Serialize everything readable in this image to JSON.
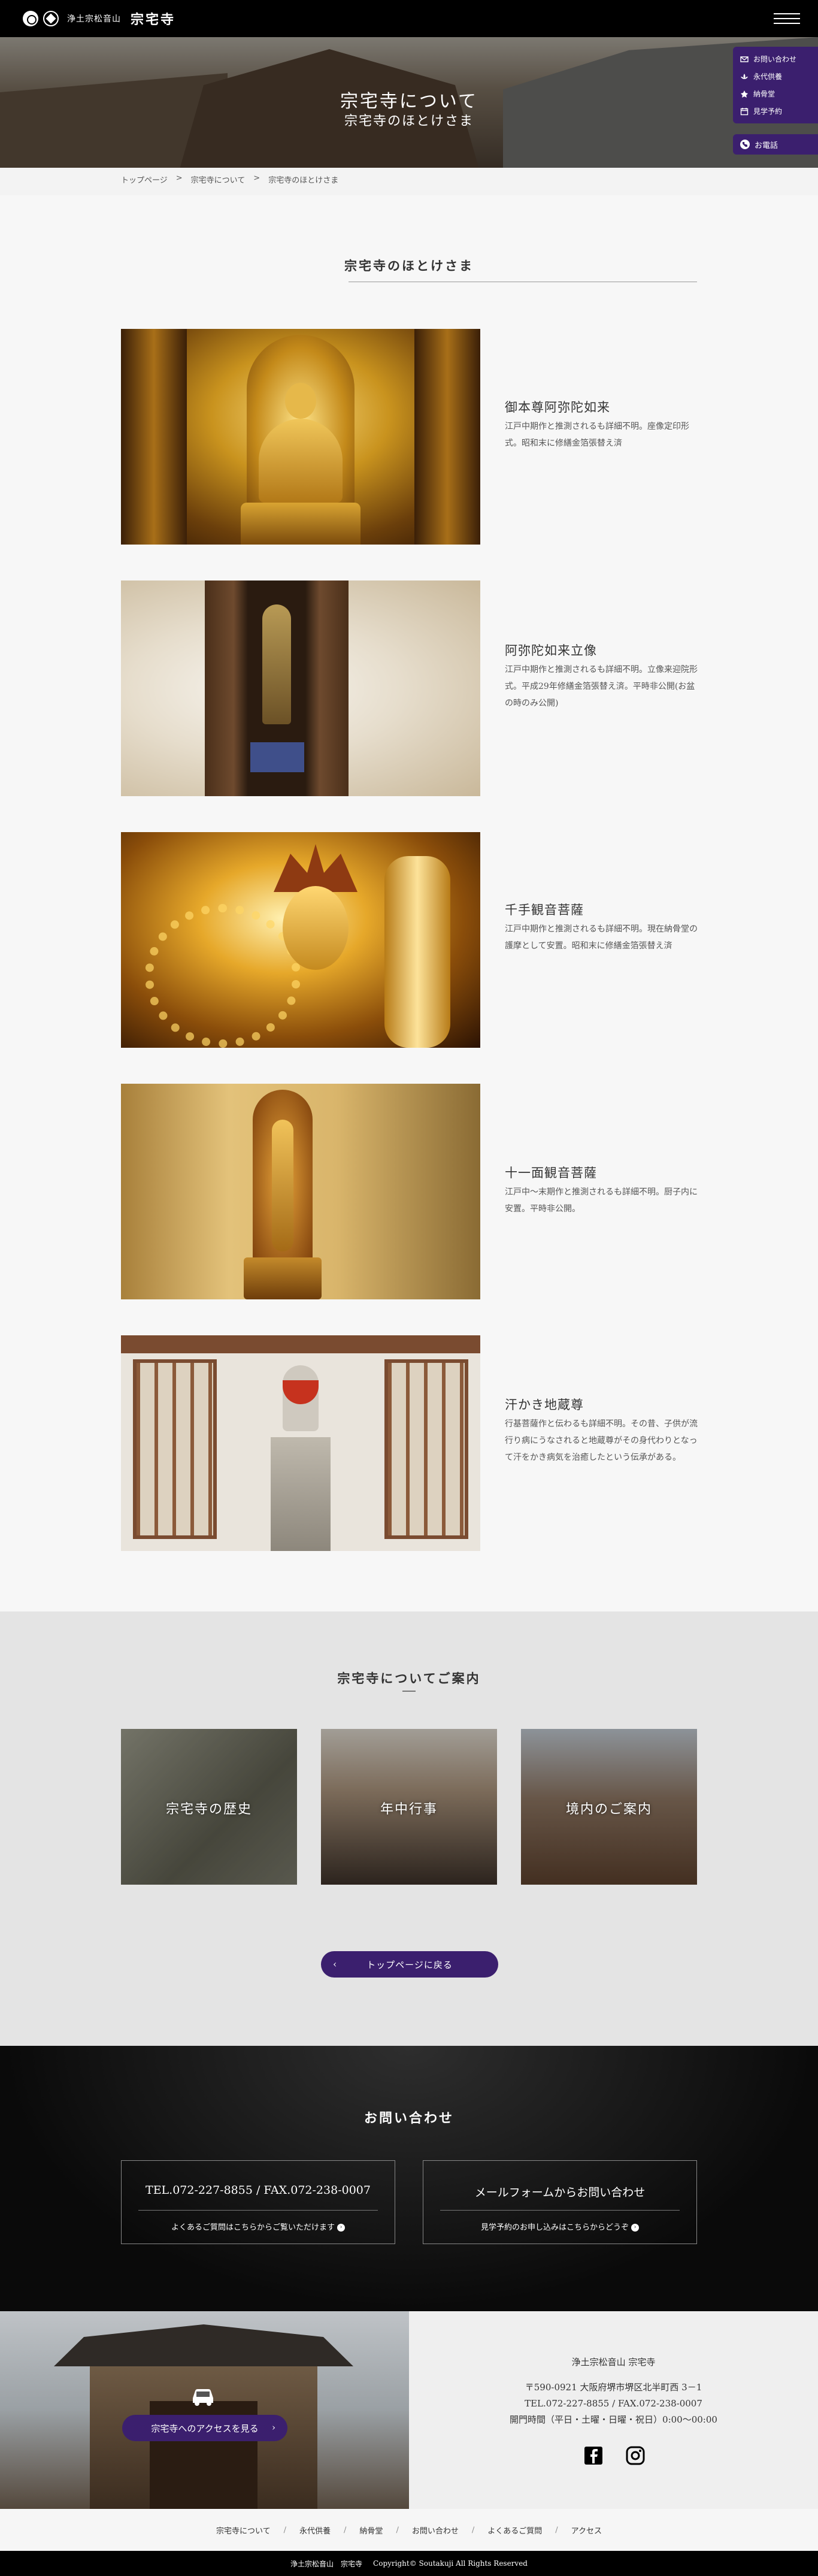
{
  "header": {
    "logo_sub": "浄土宗松音山",
    "logo_main": "宗宅寺"
  },
  "hero": {
    "title": "宗宅寺について",
    "subtitle": "宗宅寺のほとけさま"
  },
  "side_nav": {
    "items": [
      {
        "label": "お問い合わせ",
        "icon": "mail-icon"
      },
      {
        "label": "永代供養",
        "icon": "lotus-icon"
      },
      {
        "label": "納骨堂",
        "icon": "flower-icon"
      },
      {
        "label": "見学予約",
        "icon": "calendar-icon"
      }
    ],
    "call_label": "お電話"
  },
  "breadcrumb": {
    "items": [
      "トップページ",
      ">",
      "宗宅寺について",
      ">",
      "宗宅寺のほとけさま"
    ]
  },
  "main": {
    "title": "宗宅寺のほとけさま",
    "items": [
      {
        "name": "御本尊阿弥陀如来",
        "desc": "江戸中期作と推測されるも詳細不明。座像定印形式。昭和末に修繕金箔張替え済"
      },
      {
        "name": "阿弥陀如来立像",
        "desc": "江戸中期作と推測されるも詳細不明。立像来迎院形式。平成29年修繕金箔張替え済。平時非公開(お盆の時のみ公開)"
      },
      {
        "name": "千手観音菩薩",
        "desc": "江戸中期作と推測されるも詳細不明。現在納骨堂の護摩として安置。昭和末に修繕金箔張替え済"
      },
      {
        "name": "十一面観音菩薩",
        "desc": "江戸中〜末期作と推測されるも詳細不明。厨子内に安置。平時非公開。"
      },
      {
        "name": "汗かき地蔵尊",
        "desc": "行基菩薩作と伝わるも詳細不明。その昔、子供が流行り病にうなされると地蔵尊がその身代わりとなって汗をかき病気を治癒したという伝承がある。"
      }
    ]
  },
  "guide": {
    "title": "宗宅寺についてご案内",
    "cards": [
      "宗宅寺の歴史",
      "年中行事",
      "境内のご案内"
    ],
    "back_label": "トップページに戻る"
  },
  "contact": {
    "title": "お問い合わせ",
    "phone_main": "TEL.072-227-8855 / FAX.072-238-0007",
    "phone_sub": "よくあるご質問はこちらからご覧いただけます",
    "mail_main": "メールフォームからお問い合わせ",
    "mail_sub": "見学予約のお申し込みはこちらからどうぞ"
  },
  "footer": {
    "access_label": "宗宅寺へのアクセスを見る",
    "org_sub": "浄土宗松音山 宗宅寺",
    "address": "〒590-0921 大阪府堺市堺区北半町西 3－1",
    "tel": "TEL.072-227-8855 / FAX.072-238-0007",
    "hours": "開門時間（平日・土曜・日曜・祝日）0:00～00:00",
    "links": [
      "宗宅寺について",
      "永代供養",
      "納骨堂",
      "お問い合わせ",
      "よくあるご質問",
      "アクセス"
    ],
    "copyright_org": "浄土宗松音山　宗宅寺",
    "copyright_text": "Copyright© Soutakuji All Rights Reserved"
  },
  "colors": {
    "accent": "#3b1f6e",
    "header_bg": "#000000"
  }
}
